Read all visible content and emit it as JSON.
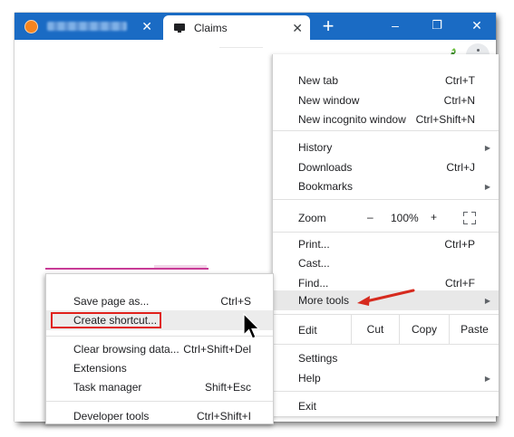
{
  "tabs": [
    {
      "title": "",
      "favicon": "orange-circle-icon",
      "active": false
    },
    {
      "title": "Claims",
      "favicon": "monitor-icon",
      "active": true
    }
  ],
  "window_controls": {
    "minimize": "–",
    "restore": "❐",
    "close": "✕",
    "new_tab": "+"
  },
  "colors": {
    "titlebar": "#1a6bc4",
    "highlight": "#e8e8e8",
    "annotation_red": "#e0201b"
  },
  "menu": {
    "new_tab": {
      "label": "New tab",
      "shortcut": "Ctrl+T"
    },
    "new_window": {
      "label": "New window",
      "shortcut": "Ctrl+N"
    },
    "new_incognito": {
      "label": "New incognito window",
      "shortcut": "Ctrl+Shift+N"
    },
    "history": {
      "label": "History"
    },
    "downloads": {
      "label": "Downloads",
      "shortcut": "Ctrl+J"
    },
    "bookmarks": {
      "label": "Bookmarks"
    },
    "zoom": {
      "label": "Zoom",
      "minus": "–",
      "value": "100%",
      "plus": "+"
    },
    "print": {
      "label": "Print...",
      "shortcut": "Ctrl+P"
    },
    "cast": {
      "label": "Cast..."
    },
    "find": {
      "label": "Find...",
      "shortcut": "Ctrl+F"
    },
    "more_tools": {
      "label": "More tools"
    },
    "edit": {
      "label": "Edit",
      "cut": "Cut",
      "copy": "Copy",
      "paste": "Paste"
    },
    "settings": {
      "label": "Settings"
    },
    "help": {
      "label": "Help"
    },
    "exit": {
      "label": "Exit"
    }
  },
  "submenu": {
    "save_page": {
      "label": "Save page as...",
      "shortcut": "Ctrl+S"
    },
    "create_shortcut": {
      "label": "Create shortcut..."
    },
    "clear_browsing": {
      "label": "Clear browsing data...",
      "shortcut": "Ctrl+Shift+Del"
    },
    "extensions": {
      "label": "Extensions"
    },
    "task_manager": {
      "label": "Task manager",
      "shortcut": "Shift+Esc"
    },
    "developer_tools": {
      "label": "Developer tools",
      "shortcut": "Ctrl+Shift+I"
    }
  }
}
